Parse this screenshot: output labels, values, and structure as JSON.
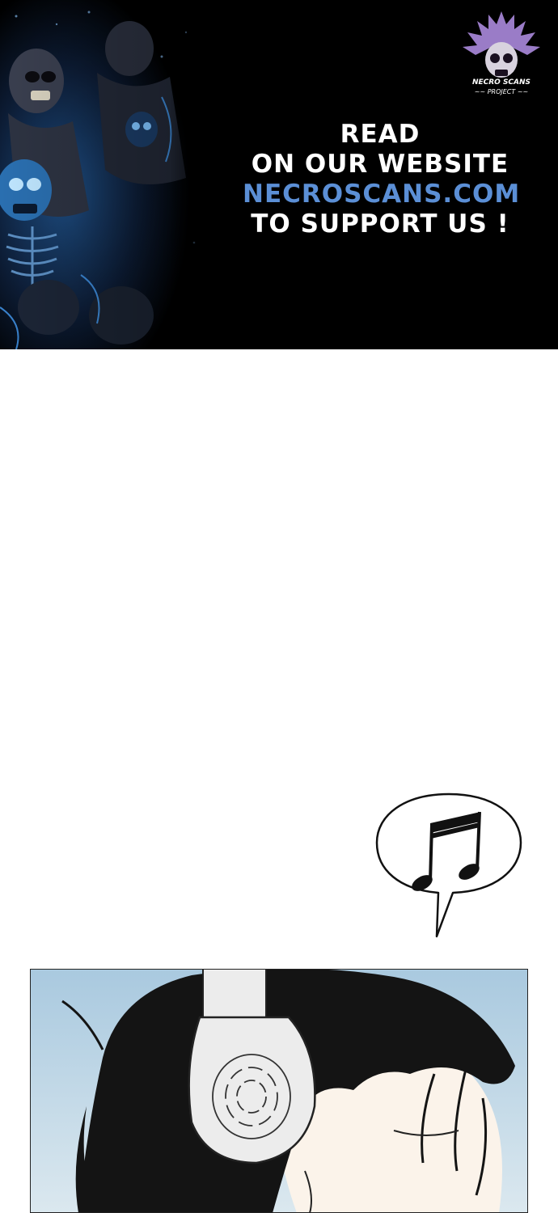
{
  "banner": {
    "logo": {
      "brand": "NECRO SCANS",
      "subtitle": "~~ PROJECT ~~",
      "icon": "skull-logo-icon"
    },
    "promo_lines": {
      "line1": "READ",
      "line2": "ON OUR WEBSITE",
      "line3": "NECROSCANS.COM",
      "line4": "TO SUPPORT US !"
    },
    "colors": {
      "background": "#000000",
      "text": "#ffffff",
      "website": "#5b8fd6",
      "art_blue": "#2a6fb0"
    }
  },
  "speech_bubble": {
    "icon": "music-notes-icon"
  },
  "comic_panel": {
    "subject": "person-with-headphones",
    "colors": {
      "sky": "#b9d3e3",
      "hair": "#141414",
      "headphones": "#ececec",
      "skin": "#fbf3ea"
    }
  }
}
